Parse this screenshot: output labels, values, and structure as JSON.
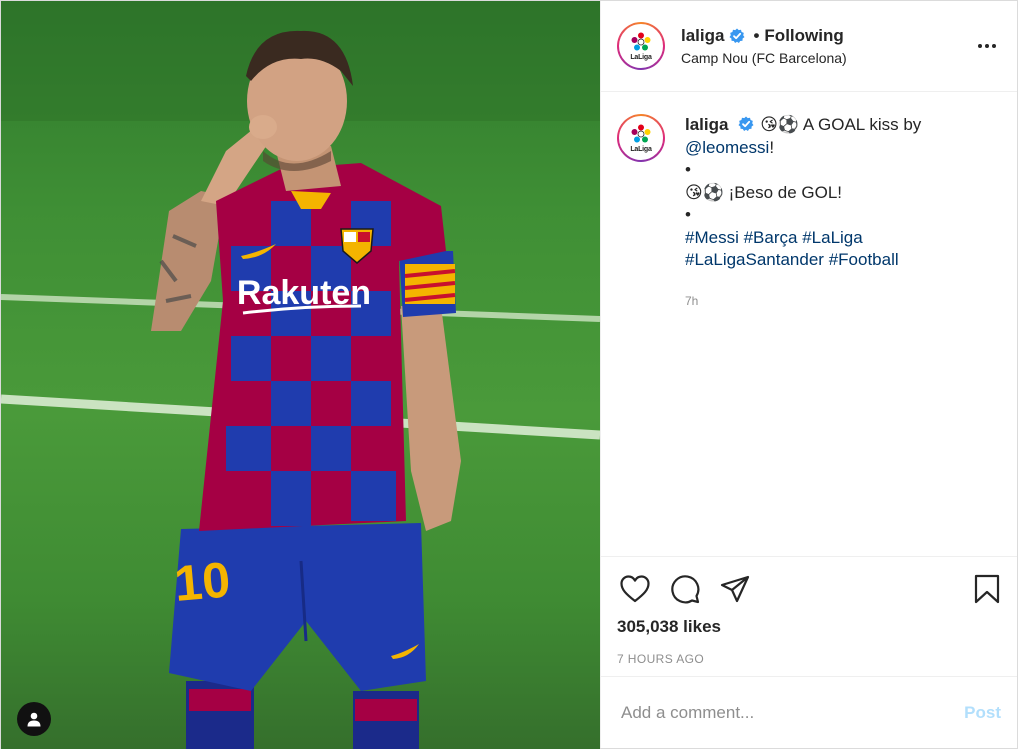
{
  "account": {
    "username": "laliga",
    "logo_text": "LaLiga",
    "follow_label": "Following",
    "separator": "•",
    "location": "Camp Nou (FC Barcelona)"
  },
  "photo": {
    "shirt_sponsor": "Rakuten",
    "shirt_number": "10"
  },
  "caption": {
    "username": "laliga",
    "line1_emoji": "😘⚽",
    "line1_text": " A GOAL kiss by ",
    "mention": "@leomessi",
    "line1_end": "!",
    "bullet1": "•",
    "line2_emoji": "😘⚽",
    "line2_text": " ¡Beso de GOL!",
    "bullet2": "•",
    "hashtags": [
      "#Messi",
      "#Barça",
      "#LaLiga",
      "#LaLigaSantander",
      "#Football"
    ],
    "time": "7h"
  },
  "stats": {
    "likes": "305,038 likes",
    "time_ago": "7 HOURS AGO"
  },
  "comment": {
    "placeholder": "Add a comment...",
    "post_label": "Post"
  },
  "icons": {
    "like": "heart-icon",
    "comment": "comment-bubble-icon",
    "share": "paper-plane-icon",
    "save": "bookmark-icon",
    "more": "ellipsis-icon",
    "verified": "verified-badge-icon",
    "tag": "user-tag-icon"
  },
  "colors": {
    "verified_blue": "#3897f0",
    "link": "#00376b",
    "muted": "#8e8e8e",
    "post_button": "#b2dffc"
  }
}
